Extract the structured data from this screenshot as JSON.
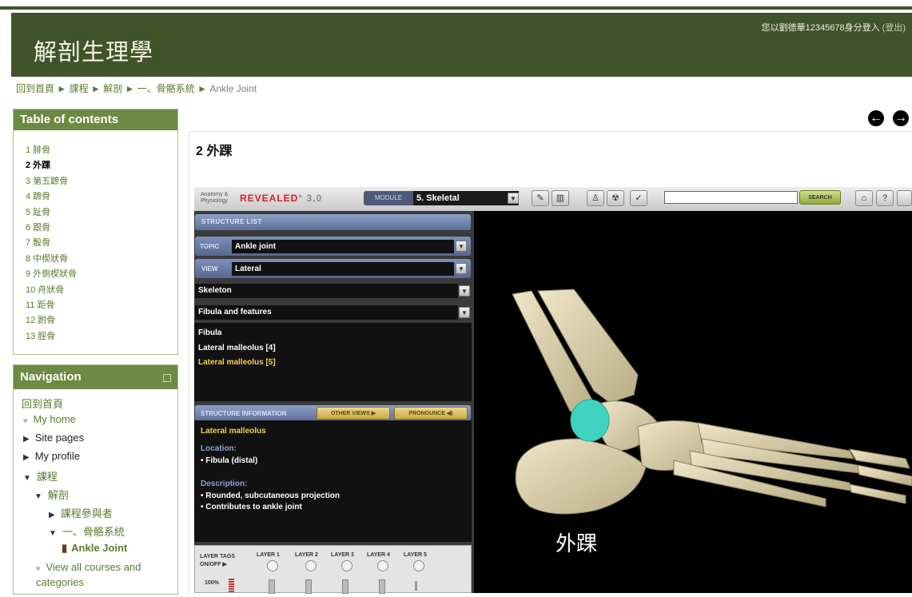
{
  "site": {
    "title": "解剖生理學",
    "login_prefix": "您以劉德華12345678身分登入",
    "logout_label": "(登出)"
  },
  "breadcrumb": [
    "回到首頁",
    "課程",
    "解剖",
    "一、骨骼系統",
    "Ankle Joint"
  ],
  "breadcrumb_separator": "►",
  "toc": {
    "title": "Table of contents",
    "items": [
      "1 腓骨",
      "2 外踝",
      "3 第五蹠骨",
      "4 蹠骨",
      "5 趾骨",
      "6 跟骨",
      "7 骰骨",
      "8 中楔狀骨",
      "9 外側楔狀骨",
      "10 舟狀骨",
      "11 距骨",
      "12 跗骨",
      "13 脛骨"
    ],
    "active_index": 1
  },
  "navigation": {
    "title": "Navigation",
    "home": "回到首頁",
    "my_home": "My home",
    "site_pages": "Site pages",
    "my_profile": "My profile",
    "courses": "課程",
    "anatomy": "解剖",
    "participants": "課程參與者",
    "skeletal": "一、骨骼系統",
    "current": "Ankle Joint",
    "view_all": "View all courses and categories"
  },
  "chapter": {
    "title": "2 外踝"
  },
  "app": {
    "logo_line1": "Anatomy &",
    "logo_line2": "Physiology",
    "revealed": "REVEALED",
    "version": "3.0",
    "module_label": "MODULE",
    "module_value": "5. Skeletal",
    "search_label": "SEARCH",
    "structure_list_label": "STRUCTURE LIST",
    "topic_label": "TOPIC",
    "topic_value": "Ankle joint",
    "view_label": "VIEW",
    "view_value": "Lateral",
    "system_value": "Skeleton",
    "group_value": "Fibula and features",
    "structures": [
      "Fibula",
      "Lateral malleolus [4]",
      "Lateral malleolus [5]"
    ],
    "selected_structure_index": 2,
    "info_label": "STRUCTURE INFORMATION",
    "other_views": "OTHER VIEWS",
    "pronounce": "PRONOUNCE",
    "info_title": "Lateral malleolus",
    "location_label": "Location:",
    "location_text": "• Fibula (distal)",
    "description_label": "Description:",
    "desc_1": "• Rounded, subcutaneous projection",
    "desc_2": "• Contributes to ankle joint",
    "layer_tags_1": "LAYER TAGS",
    "layer_tags_2": "ON/OFF",
    "layers": [
      "LAYER 1",
      "LAYER 2",
      "LAYER 3",
      "LAYER 4",
      "LAYER 5"
    ],
    "opacity": "100%",
    "viewer_label": "外踝"
  },
  "colors": {
    "header_bg": "#41532b",
    "block_head": "#6b8a43",
    "link": "#5b7a2f",
    "highlight": "#3fd3bf",
    "selected_text": "#f2d34a"
  }
}
